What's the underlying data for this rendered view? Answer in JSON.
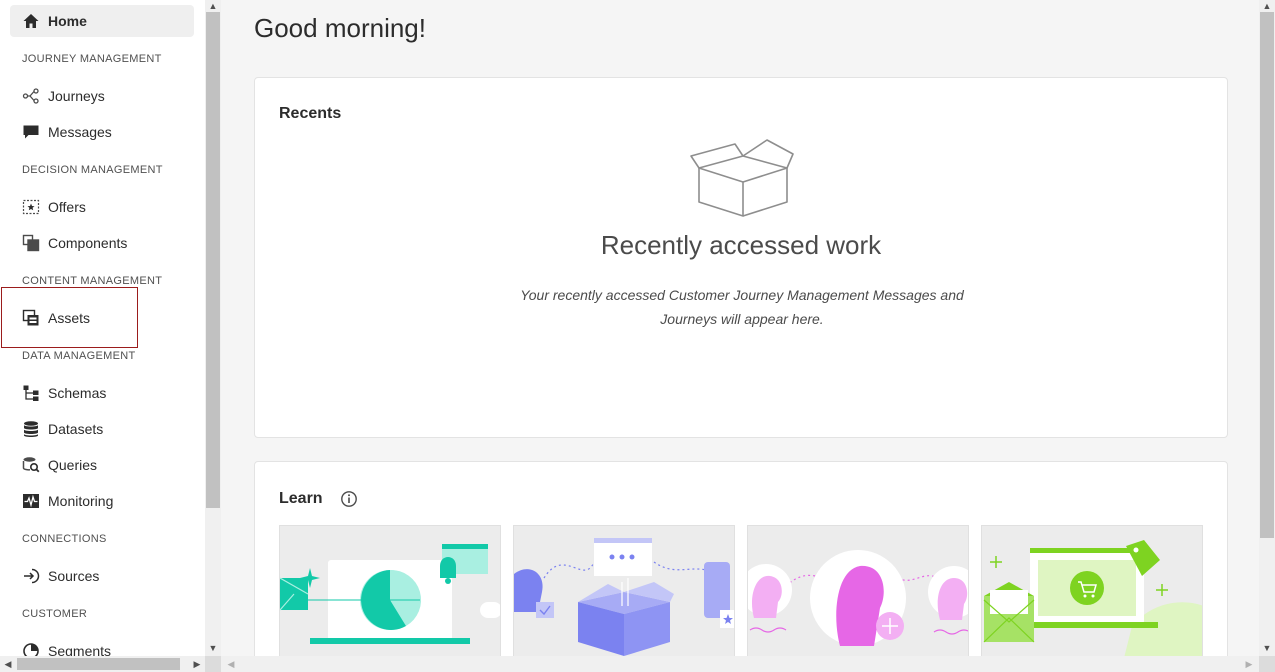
{
  "sidebar": {
    "home": "Home",
    "sections": {
      "journey": "JOURNEY MANAGEMENT",
      "decision": "DECISION MANAGEMENT",
      "content": "CONTENT MANAGEMENT",
      "data": "DATA MANAGEMENT",
      "connections": "CONNECTIONS",
      "customer": "CUSTOMER"
    },
    "items": {
      "journeys": "Journeys",
      "messages": "Messages",
      "offers": "Offers",
      "components": "Components",
      "assets": "Assets",
      "schemas": "Schemas",
      "datasets": "Datasets",
      "queries": "Queries",
      "monitoring": "Monitoring",
      "sources": "Sources",
      "segments": "Segments"
    }
  },
  "main": {
    "greeting": "Good morning!",
    "recents": {
      "title": "Recents",
      "heading": "Recently accessed work",
      "description": "Your recently accessed Customer Journey Management Messages and Journeys will appear here."
    },
    "learn": {
      "title": "Learn"
    }
  },
  "colors": {
    "highlight_border": "#9b1c1c",
    "active_bg": "#efefef",
    "teal": "#12c9a8",
    "indigo": "#7b82f0",
    "magenta": "#e667e6",
    "lime": "#7ed321"
  }
}
